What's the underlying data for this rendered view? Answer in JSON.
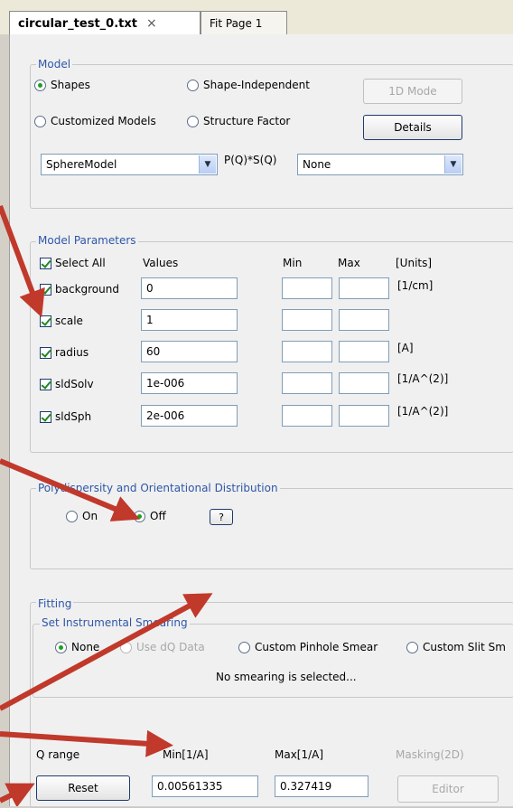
{
  "tabs": [
    {
      "label": "circular_test_0.txt",
      "close": "×"
    },
    {
      "label": "Fit Page 1"
    }
  ],
  "model": {
    "legend": "Model",
    "radios": {
      "shapes": "Shapes",
      "shape_independent": "Shape-Independent",
      "customized": "Customized Models",
      "structure_factor": "Structure Factor"
    },
    "btn_1d": "1D Mode",
    "btn_details": "Details",
    "model_select": "SphereModel",
    "pq_label": "P(Q)*S(Q)",
    "sq_select": "None"
  },
  "params": {
    "legend": "Model Parameters",
    "select_all": "Select All",
    "headers": {
      "values": "Values",
      "min": "Min",
      "max": "Max",
      "units": "[Units]"
    },
    "rows": [
      {
        "name": "background",
        "value": "0",
        "unit": "[1/cm]"
      },
      {
        "name": "scale",
        "value": "1",
        "unit": ""
      },
      {
        "name": "radius",
        "value": "60",
        "unit": "[A]"
      },
      {
        "name": "sldSolv",
        "value": "1e-006",
        "unit": "[1/A^(2)]"
      },
      {
        "name": "sldSph",
        "value": "2e-006",
        "unit": "[1/A^(2)]"
      }
    ]
  },
  "poly": {
    "legend": "Polydispersity and Orientational Distribution",
    "on": "On",
    "off": "Off",
    "help": "?"
  },
  "fitting": {
    "legend": "Fitting",
    "smear_legend": "Set Instrumental Smearing",
    "none": "None",
    "use_dq": "Use dQ Data",
    "pinhole": "Custom Pinhole Smear",
    "slit": "Custom Slit Sm",
    "status": "No smearing is selected..."
  },
  "qrange": {
    "label": "Q range",
    "min_label": "Min[1/A]",
    "max_label": "Max[1/A]",
    "masking": "Masking(2D)",
    "reset": "Reset",
    "min_value": "0.00561335",
    "max_value": "0.327419",
    "editor": "Editor"
  },
  "colors": {
    "arrow": "#c0392b",
    "legend": "#2e56a8"
  }
}
